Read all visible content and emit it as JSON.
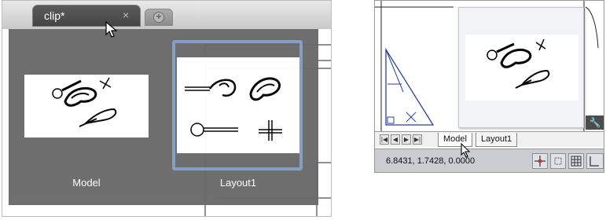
{
  "file_tab": {
    "title": "clip*",
    "close_glyph": "×"
  },
  "new_tab": {
    "icon": "plus-circle-icon"
  },
  "popup": {
    "model_label": "Model",
    "layout_label": "Layout1",
    "highlight_color": "#7f9cc0"
  },
  "layout_tabs": {
    "model": "Model",
    "layout1": "Layout1"
  },
  "status": {
    "coordinates": "6.8431, 1.7428, 0.0000"
  },
  "icons": {
    "nav_first": "first-page-icon",
    "nav_prev": "prev-page-icon",
    "nav_next": "next-page-icon",
    "nav_last": "last-page-icon",
    "wrench": "wrench-icon",
    "cursor": "mouse-pointer-icon"
  }
}
